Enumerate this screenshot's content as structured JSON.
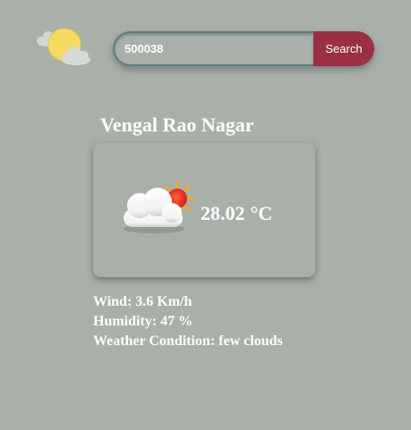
{
  "header": {
    "logo_icon": "sun-behind-cloud-icon"
  },
  "search": {
    "value": "500038",
    "button_label": "Search",
    "accent_color": "#9b2f43"
  },
  "location": {
    "name": "Vengal Rao Nagar"
  },
  "current": {
    "icon": "few-clouds-icon",
    "temperature": "28.02",
    "unit": "°C"
  },
  "details": {
    "wind_label": "Wind:",
    "wind_value": "3.6 Km/h",
    "humidity_label": "Humidity:",
    "humidity_value": "47 %",
    "condition_label": "Weather Condition:",
    "condition_value": "few clouds"
  },
  "theme": {
    "background": "#a9b0a9",
    "text": "#ffffff"
  }
}
